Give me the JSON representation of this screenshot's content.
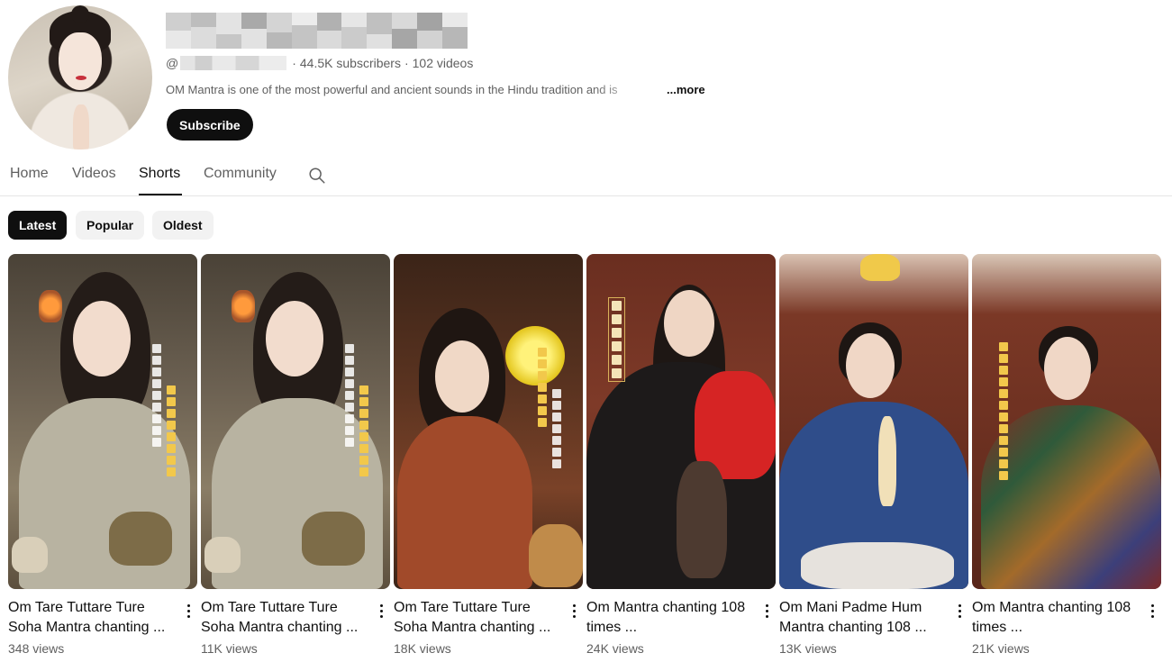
{
  "channel": {
    "handle_prefix": "@",
    "subscribers": "44.5K subscribers",
    "separator": "·",
    "video_count": "102 videos",
    "description": "OM Mantra is one of the most powerful and ancient sounds in the Hindu tradition and is",
    "more_label": "...more",
    "subscribe_label": "Subscribe"
  },
  "tabs": [
    {
      "label": "Home"
    },
    {
      "label": "Videos"
    },
    {
      "label": "Shorts",
      "active": true
    },
    {
      "label": "Community"
    }
  ],
  "search_icon": "search-icon",
  "chips": [
    {
      "label": "Latest",
      "active": true
    },
    {
      "label": "Popular"
    },
    {
      "label": "Oldest"
    }
  ],
  "shorts": [
    {
      "title": "Om Tare Tuttare Ture Soha Mantra chanting ...",
      "views": "348 views"
    },
    {
      "title": "Om Tare Tuttare Ture Soha Mantra chanting ...",
      "views": "11K views"
    },
    {
      "title": "Om Tare Tuttare Ture Soha Mantra chanting ...",
      "views": "18K views"
    },
    {
      "title": "Om Mantra chanting 108 times ...",
      "views": "24K views"
    },
    {
      "title": "Om Mani Padme Hum Mantra chanting 108 ...",
      "views": "13K views"
    },
    {
      "title": "Om Mantra chanting 108 times ...",
      "views": "21K views"
    }
  ],
  "colors": {
    "text_primary": "#0f0f0f",
    "text_secondary": "#606060",
    "chip_bg": "#f2f2f2",
    "divider": "#e5e5e5"
  }
}
